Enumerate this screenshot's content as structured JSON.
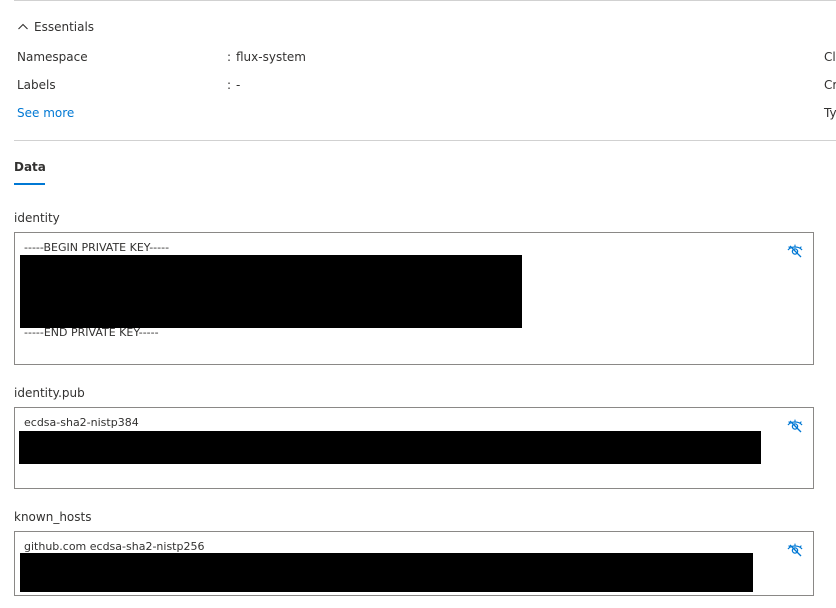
{
  "essentials": {
    "title": "Essentials",
    "rows": [
      {
        "key": "Namespace",
        "colon": ":",
        "value": "flux-system"
      },
      {
        "key": "Labels",
        "colon": ":",
        "value": "-"
      }
    ],
    "see_more": "See more",
    "right_column_labels": [
      "Cl",
      "Cr",
      "Ty"
    ]
  },
  "tabs": [
    {
      "label": "Data",
      "selected": true
    }
  ],
  "fields": [
    {
      "name": "identity",
      "lines": [
        "-----BEGIN PRIVATE KEY-----",
        "-----END PRIVATE KEY-----"
      ]
    },
    {
      "name": "identity.pub",
      "lines": [
        "ecdsa-sha2-nistp384"
      ]
    },
    {
      "name": "known_hosts",
      "lines": [
        "github.com ecdsa-sha2-nistp256"
      ]
    }
  ],
  "icons": {
    "toggle": "chevron-up-icon",
    "reveal": "eye-hide-icon"
  },
  "colors": {
    "accent": "#0078d4",
    "border": "#8a8886",
    "divider": "#d1d1d1",
    "redaction": "#000000"
  }
}
